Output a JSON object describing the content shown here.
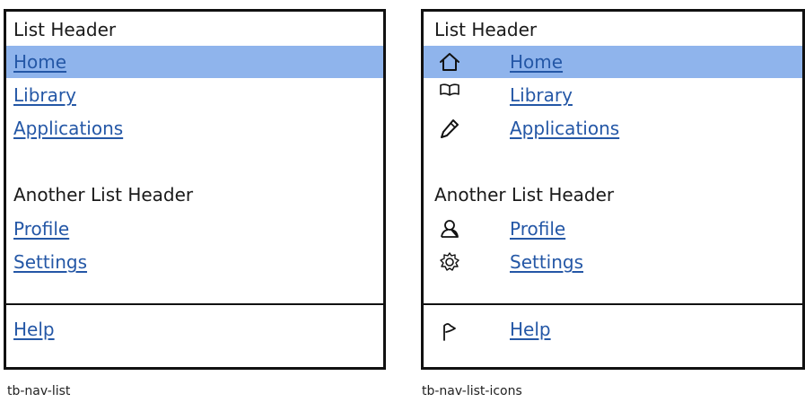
{
  "plain_list": {
    "header1": "List Header",
    "items1": [
      {
        "label": "Home",
        "selected": true
      },
      {
        "label": "Library",
        "selected": false
      },
      {
        "label": "Applications",
        "selected": false
      }
    ],
    "header2": "Another List Header",
    "items2": [
      {
        "label": "Profile"
      },
      {
        "label": "Settings"
      }
    ],
    "footer_item": "Help",
    "caption": "tb-nav-list"
  },
  "icon_list": {
    "header1": "List Header",
    "items1": [
      {
        "label": "Home",
        "icon": "home-icon",
        "selected": true
      },
      {
        "label": "Library",
        "icon": "book-icon",
        "selected": false
      },
      {
        "label": "Applications",
        "icon": "pencil-icon",
        "selected": false
      }
    ],
    "header2": "Another List Header",
    "items2": [
      {
        "label": "Profile",
        "icon": "user-icon"
      },
      {
        "label": "Settings",
        "icon": "gear-icon"
      }
    ],
    "footer_item": {
      "label": "Help",
      "icon": "flag-icon"
    },
    "caption": "tb-nav-list-icons"
  },
  "colors": {
    "selected_bg": "#8fb4ec",
    "link": "#2457a6",
    "border": "#111111"
  }
}
